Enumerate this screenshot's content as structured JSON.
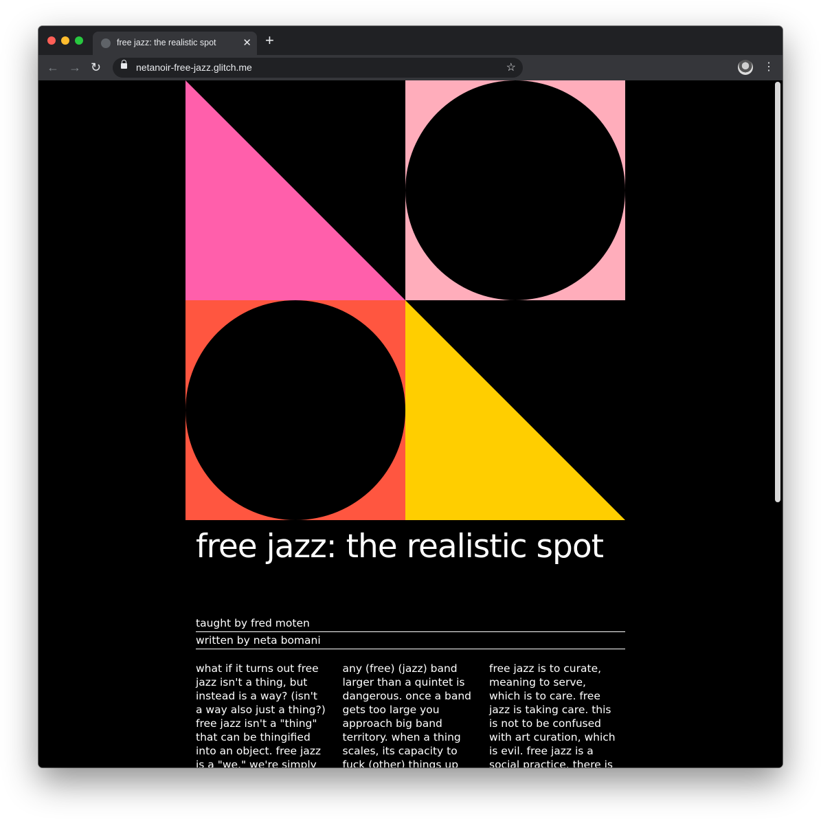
{
  "browser": {
    "tab_title": "free jazz: the realistic spot",
    "tab_close": "✕",
    "new_tab": "+",
    "url": "netanoir-free-jazz.glitch.me",
    "back": "←",
    "forward": "→",
    "reload": "↻",
    "star": "☆",
    "menu": "⋮"
  },
  "hero": {
    "colors": {
      "pink": "#ff5fab",
      "light_pink": "#ffadbb",
      "red_orange": "#ff5640",
      "yellow": "#ffce00",
      "black": "#000000"
    }
  },
  "article": {
    "title": "free jazz: the realistic spot",
    "taught_by": "taught by fred moten",
    "written_by": "written by neta bomani",
    "columns": [
      "what if it turns out free jazz isn't a thing, but instead is a way? (isn't a way also just a thing?) free jazz isn't a \"thing\" that can be thingified into an object. free jazz is a \"we.\" we're simply on the",
      "any (free) (jazz) band larger than a quintet is dangerous. once a band gets too large you approach big band territory. when a thing scales, its capacity to fuck (other) things up",
      "free jazz is to curate, meaning to serve, which is to care. free jazz is taking care. this is not to be confused with art curation, which is evil. free jazz is a social practice. there is no"
    ]
  }
}
